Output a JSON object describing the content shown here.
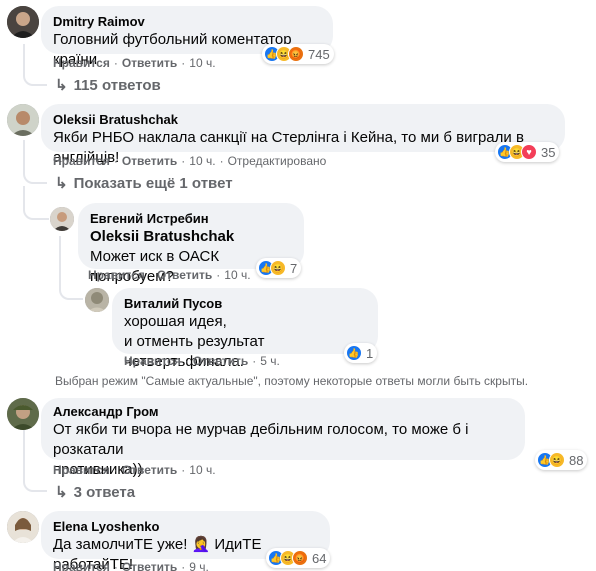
{
  "labels": {
    "like": "Нравится",
    "reply": "Ответить",
    "edited": "Отредактировано"
  },
  "comments": [
    {
      "author": "Dmitry Raimov",
      "text": "Головний футбольний коментатор країни",
      "time": "10 ч.",
      "reactions": [
        "like",
        "haha",
        "angry"
      ],
      "reaction_count": "745"
    },
    {
      "author": "Oleksii Bratushchak",
      "text": "Якби РНБО наклала санкції на Стерлінга і Кейна, то ми б виграли в англійців!",
      "time": "10 ч.",
      "reactions": [
        "like",
        "haha",
        "love"
      ],
      "reaction_count": "35"
    },
    {
      "author": "Евгений Истребин",
      "mention": "Oleksii Bratushchak",
      "text": "Может иск в ОАСК попробуем?",
      "time": "10 ч.",
      "reactions": [
        "like",
        "haha"
      ],
      "reaction_count": "7"
    },
    {
      "author": "Виталий Пусов",
      "text": "хорошая идея,\nи отменть результат четвертьфинала.",
      "time": "5 ч.",
      "reactions": [
        "like"
      ],
      "reaction_count": "1"
    },
    {
      "author": "Александр Гром",
      "text": "От якби ти вчора не мурчав дебільним голосом, то може б і розкатали\nпротивника))",
      "time": "10 ч.",
      "reactions": [
        "like",
        "haha"
      ],
      "reaction_count": "88"
    },
    {
      "author": "Elena Lyoshenko",
      "text": "Да замолчиТЕ уже! 🤦‍♀️ ИдиТЕ работайТЕ!",
      "time": "9 ч.",
      "reactions": [
        "like",
        "haha",
        "angry"
      ],
      "reaction_count": "64"
    }
  ],
  "links": {
    "replies_115": "115 ответов",
    "show_more": "Показать ещё 1 ответ",
    "replies_3": "3 ответа"
  },
  "notice": "Выбран режим \"Самые актуальные\", поэтому некоторые ответы могли быть скрыты.",
  "colors": {
    "bubble": "#f0f2f5",
    "muted": "#65676b",
    "like": "#1877f2",
    "haha": "#f7b928",
    "angry": "#e9710f",
    "love": "#f33e58"
  }
}
